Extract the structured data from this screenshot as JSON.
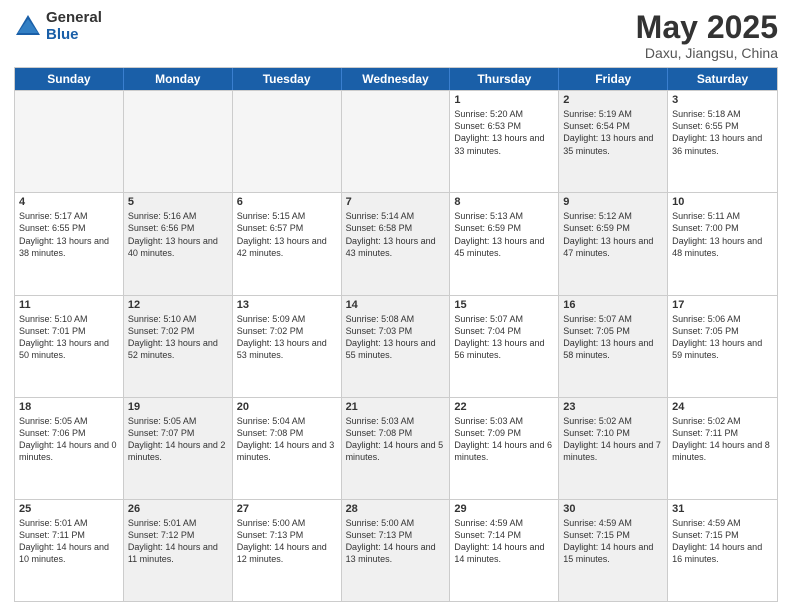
{
  "logo": {
    "general": "General",
    "blue": "Blue"
  },
  "title": "May 2025",
  "location": "Daxu, Jiangsu, China",
  "days": [
    "Sunday",
    "Monday",
    "Tuesday",
    "Wednesday",
    "Thursday",
    "Friday",
    "Saturday"
  ],
  "weeks": [
    [
      {
        "day": "",
        "info": "",
        "empty": true
      },
      {
        "day": "",
        "info": "",
        "empty": true
      },
      {
        "day": "",
        "info": "",
        "empty": true
      },
      {
        "day": "",
        "info": "",
        "empty": true
      },
      {
        "day": "1",
        "info": "Sunrise: 5:20 AM\nSunset: 6:53 PM\nDaylight: 13 hours\nand 33 minutes.",
        "empty": false
      },
      {
        "day": "2",
        "info": "Sunrise: 5:19 AM\nSunset: 6:54 PM\nDaylight: 13 hours\nand 35 minutes.",
        "empty": false,
        "shaded": true
      },
      {
        "day": "3",
        "info": "Sunrise: 5:18 AM\nSunset: 6:55 PM\nDaylight: 13 hours\nand 36 minutes.",
        "empty": false
      }
    ],
    [
      {
        "day": "4",
        "info": "Sunrise: 5:17 AM\nSunset: 6:55 PM\nDaylight: 13 hours\nand 38 minutes.",
        "empty": false
      },
      {
        "day": "5",
        "info": "Sunrise: 5:16 AM\nSunset: 6:56 PM\nDaylight: 13 hours\nand 40 minutes.",
        "empty": false,
        "shaded": true
      },
      {
        "day": "6",
        "info": "Sunrise: 5:15 AM\nSunset: 6:57 PM\nDaylight: 13 hours\nand 42 minutes.",
        "empty": false
      },
      {
        "day": "7",
        "info": "Sunrise: 5:14 AM\nSunset: 6:58 PM\nDaylight: 13 hours\nand 43 minutes.",
        "empty": false,
        "shaded": true
      },
      {
        "day": "8",
        "info": "Sunrise: 5:13 AM\nSunset: 6:59 PM\nDaylight: 13 hours\nand 45 minutes.",
        "empty": false
      },
      {
        "day": "9",
        "info": "Sunrise: 5:12 AM\nSunset: 6:59 PM\nDaylight: 13 hours\nand 47 minutes.",
        "empty": false,
        "shaded": true
      },
      {
        "day": "10",
        "info": "Sunrise: 5:11 AM\nSunset: 7:00 PM\nDaylight: 13 hours\nand 48 minutes.",
        "empty": false
      }
    ],
    [
      {
        "day": "11",
        "info": "Sunrise: 5:10 AM\nSunset: 7:01 PM\nDaylight: 13 hours\nand 50 minutes.",
        "empty": false
      },
      {
        "day": "12",
        "info": "Sunrise: 5:10 AM\nSunset: 7:02 PM\nDaylight: 13 hours\nand 52 minutes.",
        "empty": false,
        "shaded": true
      },
      {
        "day": "13",
        "info": "Sunrise: 5:09 AM\nSunset: 7:02 PM\nDaylight: 13 hours\nand 53 minutes.",
        "empty": false
      },
      {
        "day": "14",
        "info": "Sunrise: 5:08 AM\nSunset: 7:03 PM\nDaylight: 13 hours\nand 55 minutes.",
        "empty": false,
        "shaded": true
      },
      {
        "day": "15",
        "info": "Sunrise: 5:07 AM\nSunset: 7:04 PM\nDaylight: 13 hours\nand 56 minutes.",
        "empty": false
      },
      {
        "day": "16",
        "info": "Sunrise: 5:07 AM\nSunset: 7:05 PM\nDaylight: 13 hours\nand 58 minutes.",
        "empty": false,
        "shaded": true
      },
      {
        "day": "17",
        "info": "Sunrise: 5:06 AM\nSunset: 7:05 PM\nDaylight: 13 hours\nand 59 minutes.",
        "empty": false
      }
    ],
    [
      {
        "day": "18",
        "info": "Sunrise: 5:05 AM\nSunset: 7:06 PM\nDaylight: 14 hours\nand 0 minutes.",
        "empty": false
      },
      {
        "day": "19",
        "info": "Sunrise: 5:05 AM\nSunset: 7:07 PM\nDaylight: 14 hours\nand 2 minutes.",
        "empty": false,
        "shaded": true
      },
      {
        "day": "20",
        "info": "Sunrise: 5:04 AM\nSunset: 7:08 PM\nDaylight: 14 hours\nand 3 minutes.",
        "empty": false
      },
      {
        "day": "21",
        "info": "Sunrise: 5:03 AM\nSunset: 7:08 PM\nDaylight: 14 hours\nand 5 minutes.",
        "empty": false,
        "shaded": true
      },
      {
        "day": "22",
        "info": "Sunrise: 5:03 AM\nSunset: 7:09 PM\nDaylight: 14 hours\nand 6 minutes.",
        "empty": false
      },
      {
        "day": "23",
        "info": "Sunrise: 5:02 AM\nSunset: 7:10 PM\nDaylight: 14 hours\nand 7 minutes.",
        "empty": false,
        "shaded": true
      },
      {
        "day": "24",
        "info": "Sunrise: 5:02 AM\nSunset: 7:11 PM\nDaylight: 14 hours\nand 8 minutes.",
        "empty": false
      }
    ],
    [
      {
        "day": "25",
        "info": "Sunrise: 5:01 AM\nSunset: 7:11 PM\nDaylight: 14 hours\nand 10 minutes.",
        "empty": false
      },
      {
        "day": "26",
        "info": "Sunrise: 5:01 AM\nSunset: 7:12 PM\nDaylight: 14 hours\nand 11 minutes.",
        "empty": false,
        "shaded": true
      },
      {
        "day": "27",
        "info": "Sunrise: 5:00 AM\nSunset: 7:13 PM\nDaylight: 14 hours\nand 12 minutes.",
        "empty": false
      },
      {
        "day": "28",
        "info": "Sunrise: 5:00 AM\nSunset: 7:13 PM\nDaylight: 14 hours\nand 13 minutes.",
        "empty": false,
        "shaded": true
      },
      {
        "day": "29",
        "info": "Sunrise: 4:59 AM\nSunset: 7:14 PM\nDaylight: 14 hours\nand 14 minutes.",
        "empty": false
      },
      {
        "day": "30",
        "info": "Sunrise: 4:59 AM\nSunset: 7:15 PM\nDaylight: 14 hours\nand 15 minutes.",
        "empty": false,
        "shaded": true
      },
      {
        "day": "31",
        "info": "Sunrise: 4:59 AM\nSunset: 7:15 PM\nDaylight: 14 hours\nand 16 minutes.",
        "empty": false
      }
    ]
  ]
}
